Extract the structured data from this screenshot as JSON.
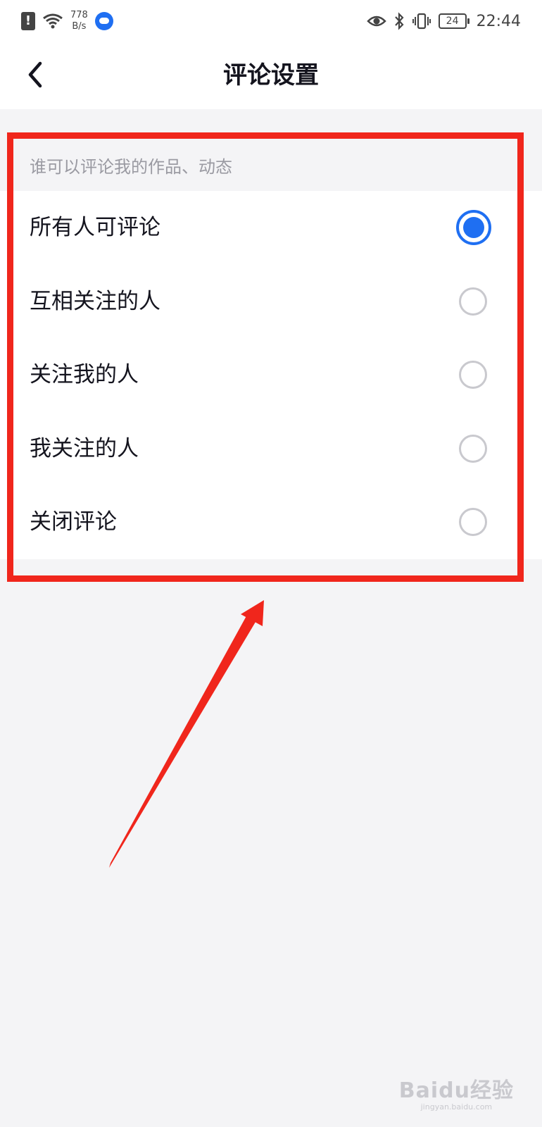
{
  "status_bar": {
    "net_speed_value": "778",
    "net_speed_unit": "B/s",
    "battery_level": "24",
    "time": "22:44"
  },
  "nav": {
    "title": "评论设置"
  },
  "section": {
    "header": "谁可以评论我的作品、动态",
    "options": [
      {
        "label": "所有人可评论",
        "selected": true
      },
      {
        "label": "互相关注的人",
        "selected": false
      },
      {
        "label": "关注我的人",
        "selected": false
      },
      {
        "label": "我关注的人",
        "selected": false
      },
      {
        "label": "关闭评论",
        "selected": false
      }
    ]
  },
  "colors": {
    "accent": "#1f6ff2",
    "annotation": "#f0261c",
    "page_background": "#f4f4f6"
  },
  "watermark": {
    "main": "Baidu经验",
    "sub": "jingyan.baidu.com"
  }
}
